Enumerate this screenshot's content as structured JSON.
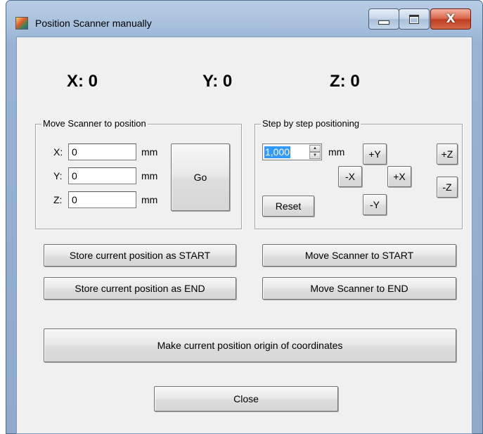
{
  "window": {
    "title": "Position Scanner manually",
    "close_glyph": "X",
    "accent": "#c13e22",
    "frame_color": "#a9c1de"
  },
  "readout": {
    "x": "X: 0",
    "y": "Y: 0",
    "z": "Z: 0"
  },
  "move_group": {
    "legend": "Move Scanner to position",
    "x_label": "X:",
    "y_label": "Y:",
    "z_label": "Z:",
    "x_value": "0",
    "y_value": "0",
    "z_value": "0",
    "unit": "mm",
    "go_label": "Go"
  },
  "step_group": {
    "legend": "Step by step positioning",
    "step_value": "1,000",
    "unit": "mm",
    "plus_y": "+Y",
    "minus_x": "-X",
    "plus_x": "+X",
    "minus_y": "-Y",
    "plus_z": "+Z",
    "minus_z": "-Z",
    "reset_label": "Reset"
  },
  "actions": {
    "store_start": "Store current position as START",
    "store_end": "Store current position as END",
    "move_start": "Move Scanner to START",
    "move_end": "Move Scanner to END",
    "make_origin": "Make current position origin of coordinates",
    "close": "Close"
  },
  "icons": {
    "app": "app-icon",
    "minimize": "minimize-icon",
    "maximize": "maximize-icon",
    "close": "close-icon",
    "spin_up": "spin-up-arrow-icon",
    "spin_down": "spin-down-arrow-icon"
  }
}
